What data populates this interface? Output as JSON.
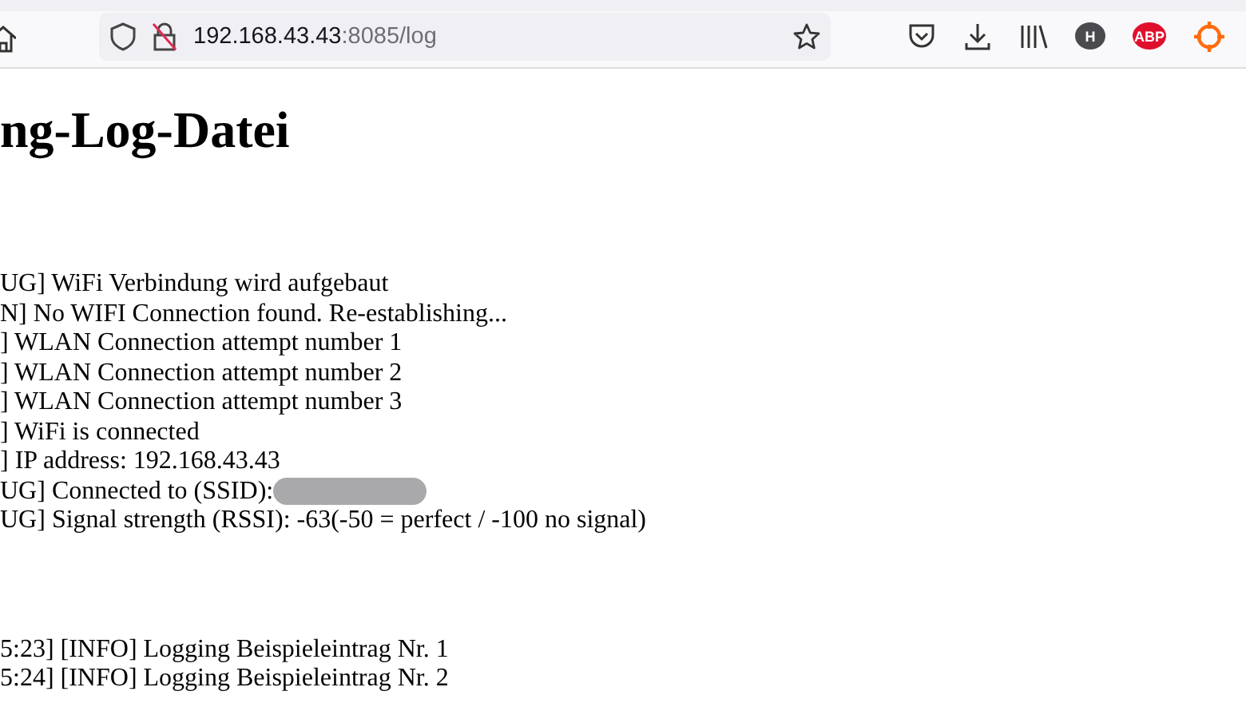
{
  "address_bar": {
    "host": "192.168.43.43",
    "path": ":8085/log"
  },
  "extensions": [
    {
      "kind": "letter",
      "label": "H",
      "color": "#4a4a4f"
    },
    {
      "kind": "letter",
      "label": "ABP",
      "color": "#e0102d"
    },
    {
      "kind": "target",
      "color": "#ff6b10"
    }
  ],
  "page": {
    "heading": "ng-Log-Datei",
    "log_groups": [
      {
        "lines": [
          {
            "text": "UG] WiFi Verbindung wird aufgebaut"
          },
          {
            "text": "N] No WIFI Connection found. Re-establishing..."
          },
          {
            "text": "] WLAN Connection attempt number 1"
          },
          {
            "text": "] WLAN Connection attempt number 2"
          },
          {
            "text": "] WLAN Connection attempt number 3"
          },
          {
            "text": "] WiFi is connected"
          },
          {
            "text": "] IP address: 192.168.43.43"
          },
          {
            "text": "UG] Connected to (SSID):",
            "redacted": true
          },
          {
            "text": "UG] Signal strength (RSSI): -63(-50 = perfect / -100 no signal)"
          }
        ]
      },
      {
        "lines": [
          {
            "text": "5:23] [INFO] Logging Beispieleintrag Nr. 1"
          },
          {
            "text": "5:24] [INFO] Logging Beispieleintrag Nr. 2"
          }
        ]
      }
    ]
  }
}
